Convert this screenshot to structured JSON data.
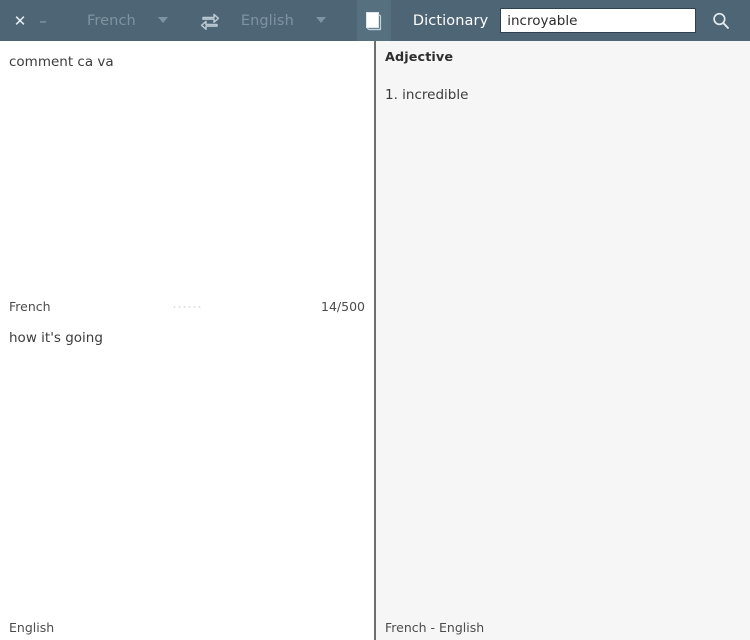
{
  "toolbar": {
    "close_label": "✕",
    "minimize_label": "–",
    "source_language": "French",
    "target_language": "English",
    "swap_icon": "swap-languages-icon",
    "dictionary_toggle_icon": "book-icon",
    "dictionary_label": "Dictionary",
    "search_value": "incroyable",
    "search_placeholder": "",
    "search_icon": "search-icon",
    "chevron_icon": "chevron-down-icon",
    "header_color": "#4e6575",
    "toggle_active_color": "#56707f"
  },
  "translator": {
    "source_text": "comment ca va",
    "source_language_label": "French",
    "character_count": "14/500",
    "translated_text": "how it's going",
    "target_language_label": "English",
    "grip_icon": "drag-handle-dots-icon"
  },
  "dictionary": {
    "part_of_speech": "Adjective",
    "entries": [
      "1. incredible"
    ],
    "status": "French - English"
  }
}
